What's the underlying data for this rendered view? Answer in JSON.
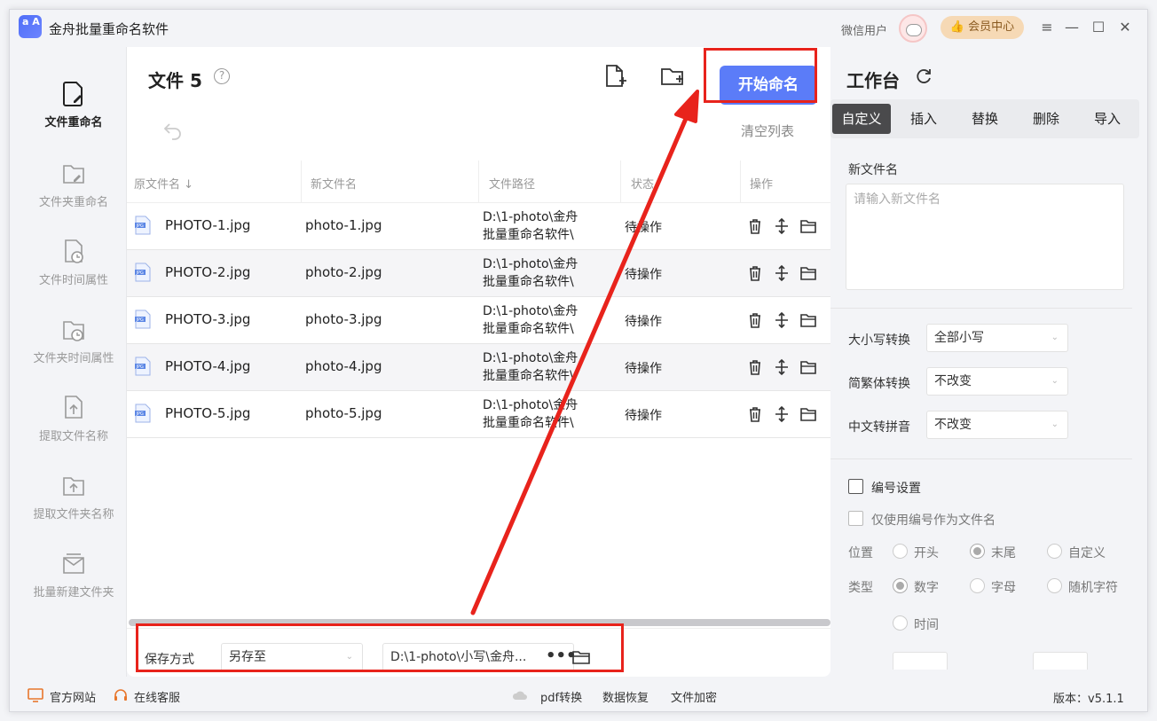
{
  "app": {
    "title": "金舟批量重命名软件",
    "logo_text": "a A",
    "user": "微信用户",
    "vip": "会员中心"
  },
  "sidebar": [
    {
      "label": "文件重命名",
      "active": true
    },
    {
      "label": "文件夹重命名"
    },
    {
      "label": "文件时间属性"
    },
    {
      "label": "文件夹时间属性"
    },
    {
      "label": "提取文件名称"
    },
    {
      "label": "提取文件夹名称"
    },
    {
      "label": "批量新建文件夹"
    }
  ],
  "main": {
    "files_label": "文件",
    "count": "5",
    "start_button": "开始命名",
    "clear_list": "清空列表",
    "columns": [
      "原文件名",
      "新文件名",
      "文件路径",
      "状态",
      "操作"
    ],
    "rows": [
      {
        "original": "PHOTO-1.jpg",
        "new_name": "photo-1.jpg",
        "path1": "D:\\1-photo\\金舟",
        "path2": "批量重命名软件\\",
        "status": "待操作"
      },
      {
        "original": "PHOTO-2.jpg",
        "new_name": "photo-2.jpg",
        "path1": "D:\\1-photo\\金舟",
        "path2": "批量重命名软件\\",
        "status": "待操作"
      },
      {
        "original": "PHOTO-3.jpg",
        "new_name": "photo-3.jpg",
        "path1": "D:\\1-photo\\金舟",
        "path2": "批量重命名软件\\",
        "status": "待操作"
      },
      {
        "original": "PHOTO-4.jpg",
        "new_name": "photo-4.jpg",
        "path1": "D:\\1-photo\\金舟",
        "path2": "批量重命名软件\\",
        "status": "待操作"
      },
      {
        "original": "PHOTO-5.jpg",
        "new_name": "photo-5.jpg",
        "path1": "D:\\1-photo\\金舟",
        "path2": "批量重命名软件\\",
        "status": "待操作"
      }
    ],
    "save": {
      "label": "保存方式",
      "mode": "另存至",
      "path": "D:\\1-photo\\小写\\金舟..."
    }
  },
  "workspace": {
    "title": "工作台",
    "tabs": [
      "自定义",
      "插入",
      "替换",
      "删除",
      "导入"
    ],
    "active_tab": "自定义",
    "new_name_label": "新文件名",
    "new_name_placeholder": "请输入新文件名",
    "case_label": "大小写转换",
    "case_value": "全部小写",
    "simp_label": "简繁体转换",
    "simp_value": "不改变",
    "pinyin_label": "中文转拼音",
    "pinyin_value": "不改变",
    "numbering_label": "编号设置",
    "only_number_label": "仅使用编号作为文件名",
    "position_label": "位置",
    "position_options": [
      "开头",
      "末尾",
      "自定义"
    ],
    "position_selected": "末尾",
    "type_label": "类型",
    "type_options": [
      "数字",
      "字母",
      "随机字符",
      "时间"
    ],
    "type_selected": "数字"
  },
  "footer": {
    "website": "官方网站",
    "service": "在线客服",
    "pdf": "pdf转换",
    "recovery": "数据恢复",
    "encrypt": "文件加密",
    "version": "版本：v5.1.1"
  },
  "colors": {
    "primary": "#5b7cf8",
    "highlight": "#e8231c",
    "vip": "#f6d9b5"
  }
}
